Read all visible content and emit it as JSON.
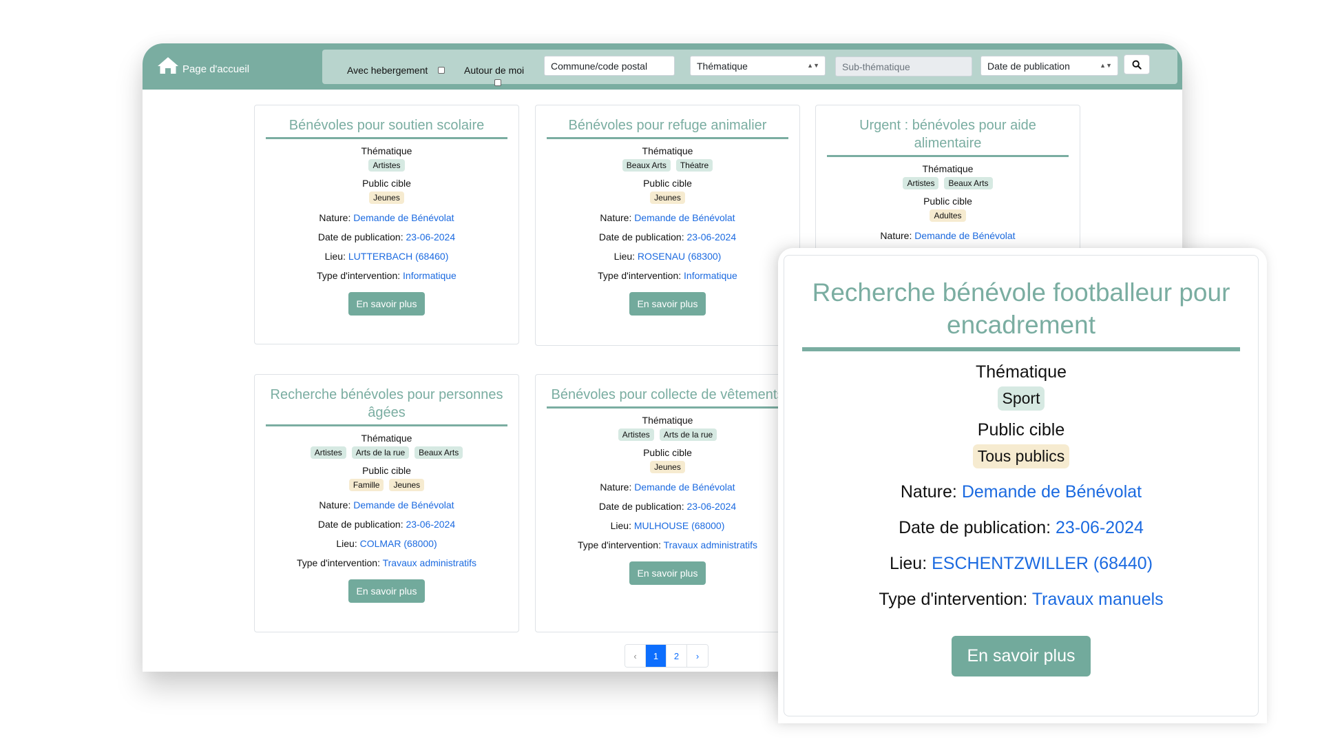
{
  "nav": {
    "home_label": "Page d'accueil"
  },
  "filters": {
    "hebergement_label": "Avec hebergement",
    "autour_label": "Autour de moi",
    "commune_placeholder": "Commune/code postal",
    "thematique_value": "Thématique",
    "subthematique_placeholder": "Sub-thématique",
    "date_value": "Date de publication"
  },
  "labels": {
    "thematique": "Thématique",
    "public": "Public cible",
    "nature": "Nature:",
    "date": "Date de publication:",
    "lieu": "Lieu:",
    "type": "Type d'intervention:",
    "button": "En savoir plus"
  },
  "cards": [
    {
      "title": "Bénévoles pour soutien scolaire",
      "themes": [
        "Artistes"
      ],
      "public": [
        "Jeunes"
      ],
      "nature": "Demande de Bénévolat",
      "date": "23-06-2024",
      "lieu": "LUTTERBACH (68460)",
      "type": "Informatique"
    },
    {
      "title": "Bénévoles pour refuge animalier",
      "themes": [
        "Beaux Arts",
        "Théatre"
      ],
      "public": [
        "Jeunes"
      ],
      "nature": "Demande de Bénévolat",
      "date": "23-06-2024",
      "lieu": "ROSENAU (68300)",
      "type": "Informatique"
    },
    {
      "title": "Urgent : bénévoles pour aide alimentaire",
      "themes": [
        "Artistes",
        "Beaux Arts"
      ],
      "public": [
        "Adultes"
      ],
      "nature": "Demande de Bénévolat"
    },
    {
      "title": "Recherche bénévoles pour personnes âgées",
      "themes": [
        "Artistes",
        "Arts de la rue",
        "Beaux Arts"
      ],
      "public": [
        "Famille",
        "Jeunes"
      ],
      "nature": "Demande de Bénévolat",
      "date": "23-06-2024",
      "lieu": "COLMAR (68000)",
      "type": "Travaux administratifs"
    },
    {
      "title": "Bénévoles pour collecte de vêtements",
      "themes": [
        "Artistes",
        "Arts de la rue"
      ],
      "public": [
        "Jeunes"
      ],
      "nature": "Demande de Bénévolat",
      "date": "23-06-2024",
      "lieu": "MULHOUSE (68000)",
      "type": "Travaux administratifs"
    }
  ],
  "pagination": {
    "prev": "‹",
    "pages": [
      "1",
      "2"
    ],
    "next": "›",
    "active": "1"
  },
  "featured": {
    "title": "Recherche bénévole footballeur pour encadrement",
    "themes": [
      "Sport"
    ],
    "public": [
      "Tous publics"
    ],
    "nature": "Demande de Bénévolat",
    "date": "23-06-2024",
    "lieu": "ESCHENTZWILLER (68440)",
    "type": "Travaux manuels"
  },
  "colors": {
    "accent": "#7aada1",
    "button": "#72aa9c",
    "link": "#1b6ae0",
    "theme_badge": "#d6e9e2",
    "public_badge": "#f6ebd0"
  },
  "icons": {
    "home": "home-icon",
    "search": "search-icon"
  }
}
